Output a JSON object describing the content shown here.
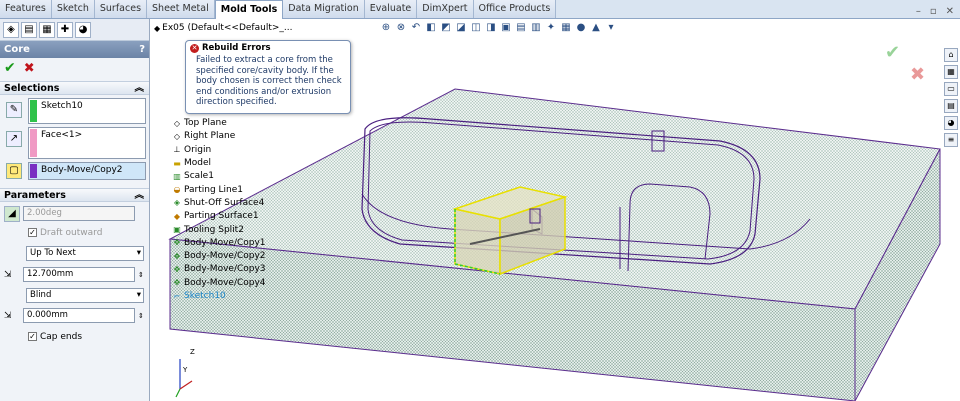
{
  "tabs": [
    "Features",
    "Sketch",
    "Surfaces",
    "Sheet Metal",
    "Mold Tools",
    "Data Migration",
    "Evaluate",
    "DimXpert",
    "Office Products"
  ],
  "active_tab": "Mold Tools",
  "panel": {
    "title": "Core",
    "help": "?",
    "selections_label": "Selections",
    "sel1": "Sketch10",
    "sel2": "Face<1>",
    "sel3": "Body-Move/Copy2",
    "parameters_label": "Parameters",
    "draft_angle": "2.00deg",
    "draft_outward": "Draft outward",
    "end_condition_1": "Up To Next",
    "depth_1": "12.700mm",
    "end_condition_2": "Blind",
    "depth_2": "0.000mm",
    "cap_ends": "Cap ends",
    "colors": {
      "sel1": "#2fc24a",
      "sel2": "#f09ac4",
      "sel3": "#7a2fc2"
    }
  },
  "tree": {
    "root": "Ex05  (Default<<Default>_...",
    "items": [
      "Top Plane",
      "Right Plane",
      "Origin",
      "Model",
      "Scale1",
      "Parting Line1",
      "Shut-Off Surface4",
      "Parting Surface1",
      "Tooling Split2",
      "Body-Move/Copy1",
      "Body-Move/Copy2",
      "Body-Move/Copy3",
      "Body-Move/Copy4",
      "Sketch10"
    ]
  },
  "error": {
    "title": "Rebuild Errors",
    "body_lines": [
      "Failed to extract a core from the",
      "specified core/cavity body. If the",
      "body chosen is correct then check",
      "end conditions and/or extrusion",
      "direction specified."
    ]
  },
  "axes": {
    "z": "Z",
    "y": "Y"
  }
}
